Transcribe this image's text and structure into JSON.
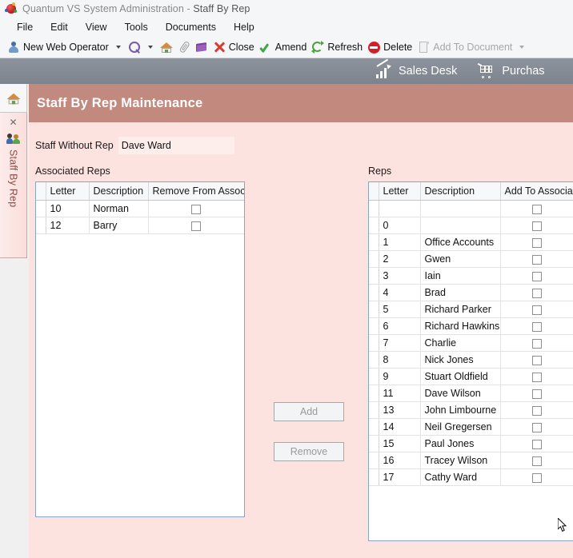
{
  "window": {
    "app_title": "Quantum VS System Administration - ",
    "document_title": "Staff By Rep",
    "app_icon": "quantum-ball-icon"
  },
  "menubar": {
    "items": [
      {
        "label": "File"
      },
      {
        "label": "Edit"
      },
      {
        "label": "View"
      },
      {
        "label": "Tools"
      },
      {
        "label": "Documents"
      },
      {
        "label": "Help"
      }
    ]
  },
  "toolbar": {
    "operator_label": "New Web Operator",
    "operator_icon": "person-icon",
    "search_icon": "search-icon",
    "home_icon": "home-icon",
    "attach_icon": "paperclip-icon",
    "book_icon": "book-icon",
    "close_label": "Close",
    "close_icon": "close-x-icon",
    "amend_label": "Amend",
    "amend_icon": "check-icon",
    "refresh_label": "Refresh",
    "refresh_icon": "refresh-icon",
    "delete_label": "Delete",
    "delete_icon": "delete-circle-icon",
    "add_to_document_label": "Add To Document",
    "add_to_document_icon": "document-icon"
  },
  "navstrip": {
    "items": [
      {
        "label": "Sales Desk",
        "icon": "chart-growth-icon"
      },
      {
        "label": "Purchas",
        "icon": "shopping-cart-icon"
      }
    ]
  },
  "sidebar": {
    "home_icon": "home-icon",
    "tab": {
      "close_glyph": "✕",
      "icon": "people-icon",
      "label": "Staff By Rep"
    }
  },
  "panel": {
    "title": "Staff By Rep Maintenance",
    "form": {
      "staff_without_rep_label": "Staff Without Rep",
      "staff_without_rep_value": "Dave Ward",
      "staff_without_rep_placeholder": ""
    },
    "associated": {
      "caption": "Associated Reps",
      "columns": [
        "Letter",
        "Description",
        "Remove From Associated"
      ],
      "rows": [
        {
          "letter": "10",
          "description": "Norman",
          "checked": false
        },
        {
          "letter": "12",
          "description": "Barry",
          "checked": false
        }
      ]
    },
    "buttons": {
      "add_label": "Add",
      "remove_label": "Remove"
    },
    "reps": {
      "caption": "Reps",
      "columns": [
        "Letter",
        "Description",
        "Add To Associated"
      ],
      "rows": [
        {
          "letter": "",
          "description": "",
          "checked": false
        },
        {
          "letter": "0",
          "description": "",
          "checked": false
        },
        {
          "letter": "1",
          "description": "Office Accounts",
          "checked": false
        },
        {
          "letter": "2",
          "description": "Gwen",
          "checked": false
        },
        {
          "letter": "3",
          "description": "Iain",
          "checked": false
        },
        {
          "letter": "4",
          "description": "Brad",
          "checked": false
        },
        {
          "letter": "5",
          "description": "Richard Parker",
          "checked": false
        },
        {
          "letter": "6",
          "description": "Richard Hawkins",
          "checked": false
        },
        {
          "letter": "7",
          "description": "Charlie",
          "checked": false
        },
        {
          "letter": "8",
          "description": "Nick Jones",
          "checked": false
        },
        {
          "letter": "9",
          "description": "Stuart Oldfield",
          "checked": false
        },
        {
          "letter": "11",
          "description": "Dave Wilson",
          "checked": false
        },
        {
          "letter": "13",
          "description": "John Limbourne",
          "checked": false
        },
        {
          "letter": "14",
          "description": "Neil Gregersen",
          "checked": false
        },
        {
          "letter": "15",
          "description": "Paul Jones",
          "checked": false
        },
        {
          "letter": "16",
          "description": "Tracey Wilson",
          "checked": false
        },
        {
          "letter": "17",
          "description": "Cathy Ward",
          "checked": false
        }
      ]
    }
  },
  "colors": {
    "panel_header": "#c2897f",
    "panel_background": "#fde3e0",
    "nav_strip": "#848a94",
    "chrome": "#f5f6f7",
    "grid_border": "#8aa4c8",
    "tab_label": "#8e4a44"
  }
}
